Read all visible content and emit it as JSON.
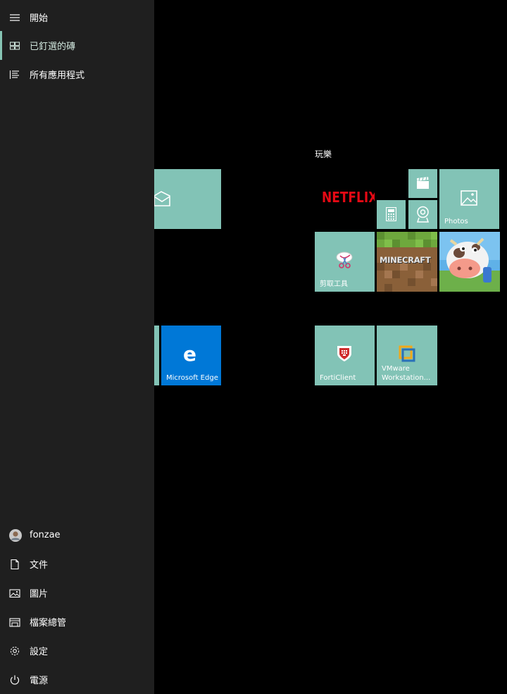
{
  "sidebar": {
    "header_label": "開始",
    "items": [
      {
        "label": "已釘選的磚",
        "icon": "tiles-icon",
        "active": true
      },
      {
        "label": "所有應用程式",
        "icon": "all-apps-list-icon",
        "active": false
      }
    ],
    "bottom_items": [
      {
        "label": "fonzae",
        "icon": "user-avatar"
      },
      {
        "label": "文件",
        "icon": "document-icon"
      },
      {
        "label": "圖片",
        "icon": "picture-icon"
      },
      {
        "label": "檔案總管",
        "icon": "file-explorer-icon"
      },
      {
        "label": "設定",
        "icon": "gear-icon"
      },
      {
        "label": "電源",
        "icon": "power-icon"
      }
    ]
  },
  "groups": {
    "play_title": "玩樂"
  },
  "tiles": {
    "mail_icon": "mail-icon",
    "edge_label": "Microsoft Edge",
    "netflix_label": "NETFLIX",
    "photos_label": "Photos",
    "snipping_label": "剪取工具",
    "minecraft_label": "MINECRAFT",
    "forticlient_label": "FortiClient",
    "vmware_label": "VMware Workstation...",
    "edge_color": "#0078d7",
    "tile_color": "#82c3b6"
  }
}
